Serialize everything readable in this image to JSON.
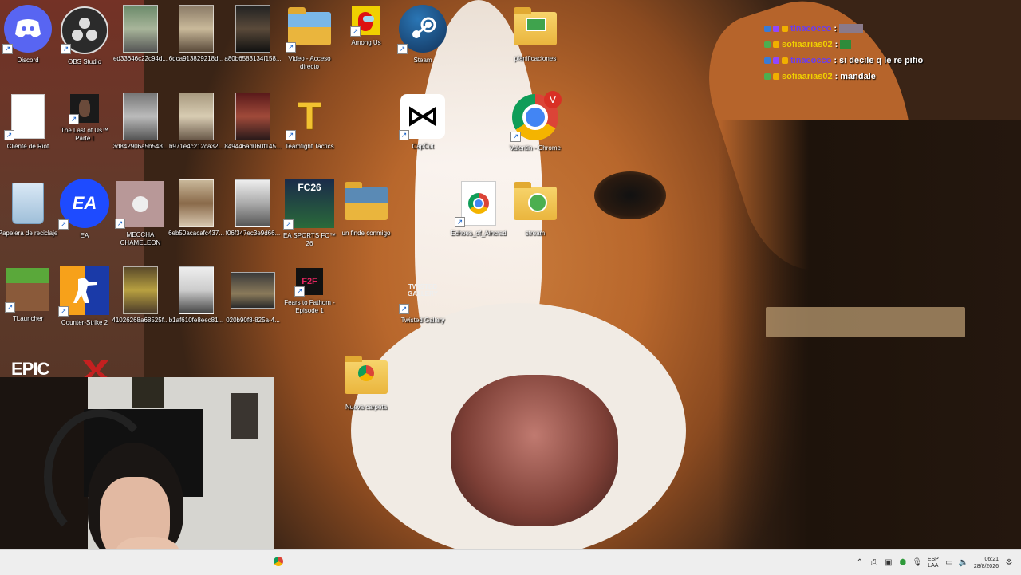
{
  "desktop": {
    "icons": [
      {
        "label": "Discord",
        "shortcut": false
      },
      {
        "label": "OBS Studio",
        "shortcut": true
      },
      {
        "label": "ed33646c22c94d...",
        "shortcut": false
      },
      {
        "label": "6dca913829218d...",
        "shortcut": false
      },
      {
        "label": "a80b6583134f158...",
        "shortcut": false
      },
      {
        "label": "Video - Acceso directo",
        "shortcut": true
      },
      {
        "label": "Among Us",
        "shortcut": true
      },
      {
        "label": "Steam",
        "shortcut": true
      },
      {
        "label": "planificaciones",
        "shortcut": false
      },
      {
        "label": "Cliente de Riot",
        "shortcut": true
      },
      {
        "label": "The Last of Us™ Parte I",
        "shortcut": true
      },
      {
        "label": "3d842906a5b548...",
        "shortcut": false
      },
      {
        "label": "b971e4c212ca32...",
        "shortcut": false
      },
      {
        "label": "849446ad060f145...",
        "shortcut": false
      },
      {
        "label": "Teamfight Tactics",
        "shortcut": true
      },
      {
        "label": "CapCut",
        "shortcut": true
      },
      {
        "label": "Valentin - Chrome",
        "shortcut": true
      },
      {
        "label": "Papelera de reciclaje",
        "shortcut": false
      },
      {
        "label": "EA",
        "shortcut": true
      },
      {
        "label": "MECCHA CHAMELEON",
        "shortcut": true
      },
      {
        "label": "6eb50acacafc437...",
        "shortcut": false
      },
      {
        "label": "f06f347ec3e9d66...",
        "shortcut": false
      },
      {
        "label": "EA SPORTS FC™ 26",
        "shortcut": true
      },
      {
        "label": "un finde conmigo",
        "shortcut": false
      },
      {
        "label": "Echoes_of_Aincrad",
        "shortcut": true
      },
      {
        "label": "stream",
        "shortcut": false
      },
      {
        "label": "TLauncher",
        "shortcut": true
      },
      {
        "label": "Counter-Strike 2",
        "shortcut": true
      },
      {
        "label": "41026268a68525f...",
        "shortcut": false
      },
      {
        "label": "b1af610fe8eec81...",
        "shortcut": false
      },
      {
        "label": "020b90f8-825a-4...",
        "shortcut": false
      },
      {
        "label": "Fears to Fathom - Episode 1",
        "shortcut": true
      },
      {
        "label": "Twisted Gallery",
        "shortcut": true
      },
      {
        "label": "Nueva carpeta",
        "shortcut": false
      }
    ],
    "tile_text": {
      "teamfight": "T",
      "f2f": "F2F",
      "twisted": "TWISTED GALLERY",
      "fc26": "FC26",
      "ea": "EA",
      "chrome_profile": "V",
      "epic": "EPIC"
    }
  },
  "chat": [
    {
      "user": "tinacocco",
      "sep": " :",
      "message": "",
      "color": "#6a3df0"
    },
    {
      "user": "sofiaarias02",
      "sep": " :",
      "message": "",
      "color": "#f0d000"
    },
    {
      "user": "tinacocco",
      "sep": " :",
      "message": "si decile q le re pifio",
      "color": "#6a3df0"
    },
    {
      "user": "sofiaarias02",
      "sep": " :",
      "message": "mandale",
      "color": "#f0d000"
    }
  ],
  "taskbar": {
    "lang_top": "ESP",
    "lang_bottom": "LAA",
    "time": "06:21",
    "date": "28/8/2026"
  },
  "colors": {
    "taskbar_bg": "#eeeeee",
    "folder": "#f0c24f",
    "discord": "#5865f2",
    "ea": "#1e4bff"
  }
}
